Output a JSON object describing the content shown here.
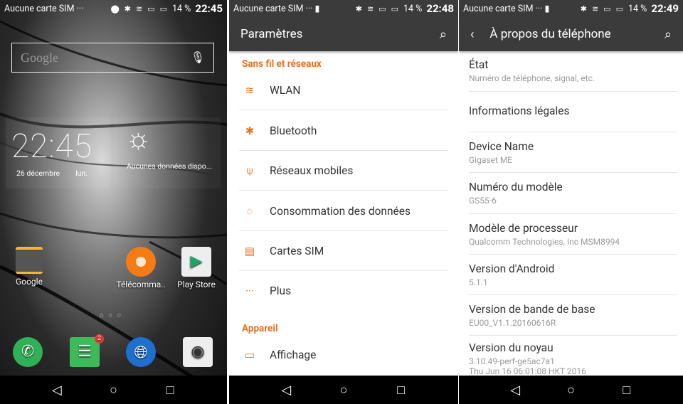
{
  "colors": {
    "accent": "#e8711c",
    "header": "#3b3b3b",
    "navbar": "#000000"
  },
  "home": {
    "status": {
      "sim": "Aucune carte SIM",
      "dots": "···",
      "battery": "14 %",
      "time": "22:45"
    },
    "search": {
      "logo": "Google",
      "mic_icon": "microphone-icon"
    },
    "clock": {
      "time": "22:45",
      "date": "26 décembre",
      "day": "lun."
    },
    "weather": {
      "text": "Aucunes données dispo..."
    },
    "apps": [
      {
        "label": "Google"
      },
      {
        "label": "Télécomma.."
      },
      {
        "label": "Play Store"
      }
    ],
    "dock": [
      {
        "name": "phone"
      },
      {
        "name": "messages",
        "badge": "2"
      },
      {
        "name": "browser"
      },
      {
        "name": "camera"
      }
    ]
  },
  "settings": {
    "status": {
      "sim": "Aucune carte SIM",
      "dots": "···",
      "battery": "14 %",
      "time": "22:48"
    },
    "title": "Paramètres",
    "sections": [
      {
        "label": "Sans fil et réseaux"
      },
      {
        "label": "Appareil"
      }
    ],
    "items": [
      {
        "label": "WLAN",
        "icon": "wifi-icon"
      },
      {
        "label": "Bluetooth",
        "icon": "bluetooth-icon"
      },
      {
        "label": "Réseaux mobiles",
        "icon": "antenna-icon"
      },
      {
        "label": "Consommation des données",
        "icon": "data-usage-icon"
      },
      {
        "label": "Cartes SIM",
        "icon": "sim-icon"
      },
      {
        "label": "Plus",
        "icon": "more-icon"
      },
      {
        "label": "Affichage",
        "icon": "display-icon"
      }
    ]
  },
  "about": {
    "status": {
      "sim": "Aucune carte SIM",
      "dots": "···",
      "battery": "14 %",
      "time": "22:49"
    },
    "title": "À propos du téléphone",
    "items": [
      {
        "title": "État",
        "sub": "Numéro de téléphone, signal, etc."
      },
      {
        "title": "Informations légales",
        "sub": ""
      },
      {
        "title": "Device Name",
        "sub": "Gigaset ME"
      },
      {
        "title": "Numéro du modèle",
        "sub": "GS55-6"
      },
      {
        "title": "Modèle de processeur",
        "sub": "Qualcomm Technologies, Inc MSM8994"
      },
      {
        "title": "Version d'Android",
        "sub": "5.1.1"
      },
      {
        "title": "Version de bande de base",
        "sub": "EU00_V1.1.20160616R"
      },
      {
        "title": "Version du noyau",
        "sub": "3.10.49-perf-ge5ac7a1",
        "sub2": "Thu Jun 16 06:01:08 HKT 2016"
      }
    ]
  }
}
